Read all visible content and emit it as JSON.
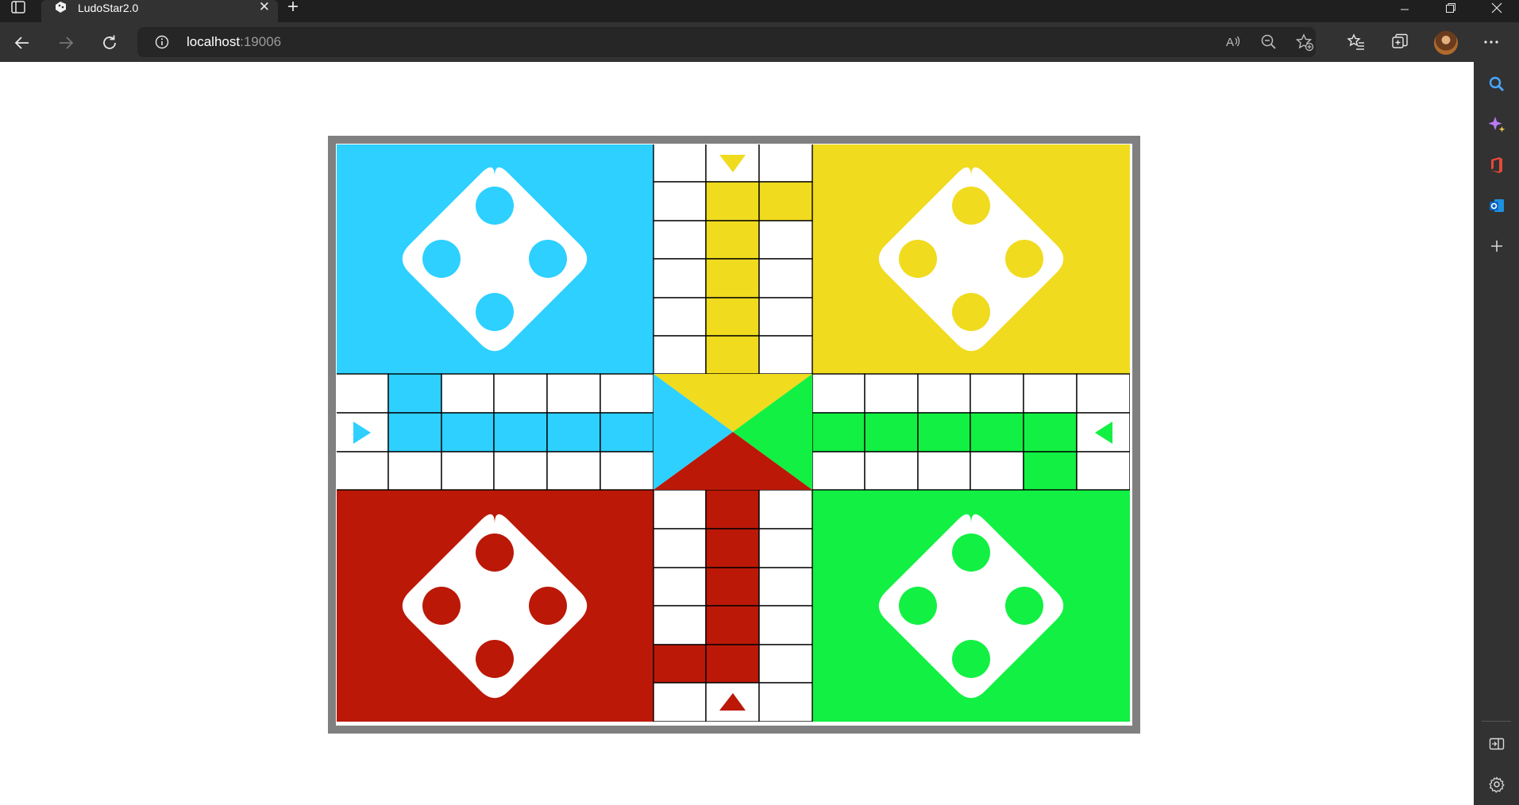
{
  "browser": {
    "tab_title": "LudoStar2.0",
    "url_host": "localhost",
    "url_port": ":19006"
  },
  "board": {
    "colors": {
      "blue": "#2dd0ff",
      "yellow": "#f0db1e",
      "red": "#bb1808",
      "green": "#12f043",
      "frame": "#808080",
      "grid_line": "#000000",
      "cell": "#ffffff"
    },
    "homes": [
      {
        "name": "blue",
        "position": "top-left",
        "color": "#2dd0ff",
        "tokens": 4
      },
      {
        "name": "yellow",
        "position": "top-right",
        "color": "#f0db1e",
        "tokens": 4
      },
      {
        "name": "red",
        "position": "bottom-left",
        "color": "#bb1808",
        "tokens": 4
      },
      {
        "name": "green",
        "position": "bottom-right",
        "color": "#12f043",
        "tokens": 4
      }
    ],
    "start_arrows": [
      {
        "color": "yellow",
        "direction": "down"
      },
      {
        "color": "blue",
        "direction": "right"
      },
      {
        "color": "green",
        "direction": "left"
      },
      {
        "color": "red",
        "direction": "up"
      }
    ]
  },
  "icons": {
    "sidebar_toggle": "sidebar-toggle-icon",
    "favicon": "ludo-favicon-icon",
    "close": "close-icon",
    "new_tab": "plus-icon",
    "back": "arrow-left-icon",
    "forward": "arrow-right-icon",
    "refresh": "refresh-icon",
    "info": "info-icon",
    "read_aloud": "read-aloud-icon",
    "zoom_out": "zoom-out-icon",
    "add_favorite": "add-favorite-icon",
    "favorites": "favorites-icon",
    "collections": "collections-icon",
    "more": "more-icon",
    "search": "search-icon",
    "copilot": "copilot-icon",
    "office": "office-icon",
    "outlook": "outlook-icon",
    "add": "plus-icon",
    "split": "split-screen-icon",
    "settings": "gear-icon"
  }
}
